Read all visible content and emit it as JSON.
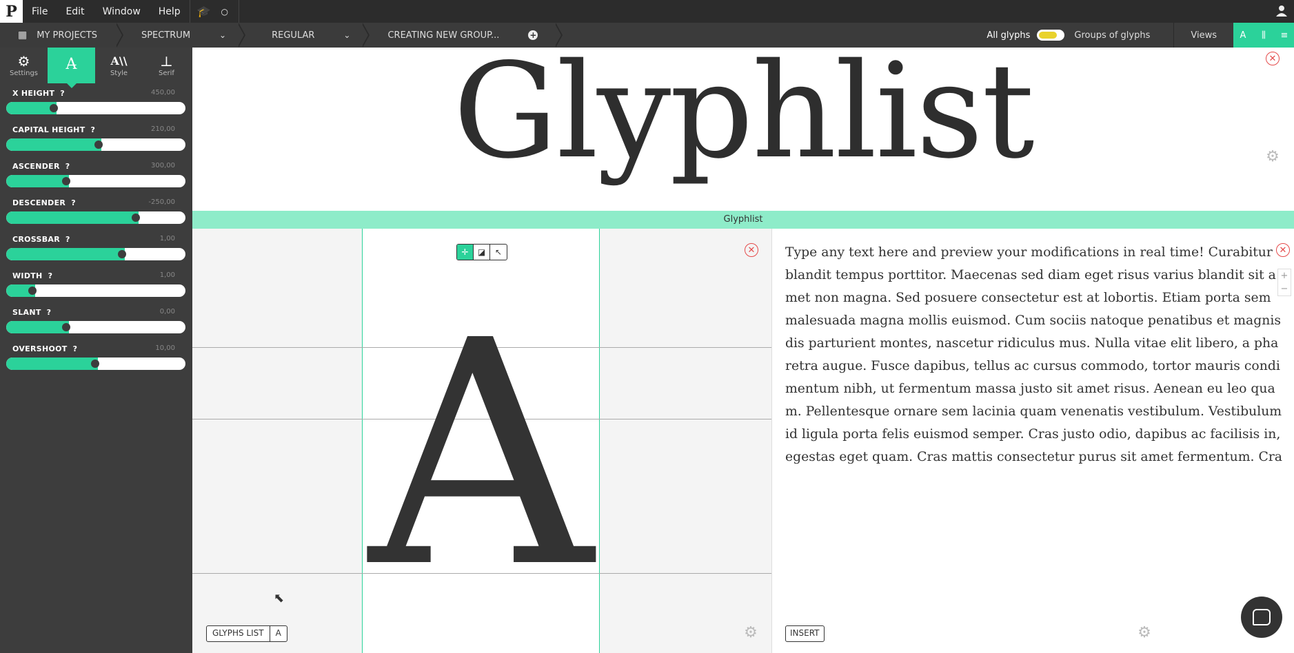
{
  "menu": {
    "logo": "P",
    "items": [
      "File",
      "Edit",
      "Window",
      "Help"
    ],
    "circle_indicator": "○"
  },
  "breadcrumb": {
    "projects": "MY PROJECTS",
    "family": "SPECTRUM",
    "variant": "REGULAR",
    "group": "CREATING NEW GROUP..."
  },
  "toolbar_right": {
    "all_glyphs": "All glyphs",
    "groups_of_glyphs": "Groups of glyphs",
    "views": "Views",
    "view_a": "A"
  },
  "sidebar": {
    "tabs": [
      {
        "label": "Settings",
        "icon": "settings-icon",
        "glyph": "⚙"
      },
      {
        "label": "",
        "icon": "font-params-icon",
        "glyph": "A̶"
      },
      {
        "label": "Style",
        "icon": "style-icon",
        "glyph": "A\\\\"
      },
      {
        "label": "Serif",
        "icon": "serif-icon",
        "glyph": "⊥"
      }
    ],
    "sliders": [
      {
        "label": "X HEIGHT",
        "value": "450,00",
        "fraction": 0.28
      },
      {
        "label": "CAPITAL HEIGHT",
        "value": "210,00",
        "fraction": 0.53
      },
      {
        "label": "ASCENDER",
        "value": "300,00",
        "fraction": 0.35
      },
      {
        "label": "DESCENDER",
        "value": "-250,00",
        "fraction": 0.74
      },
      {
        "label": "CROSSBAR",
        "value": "1,00",
        "fraction": 0.66
      },
      {
        "label": "WIDTH",
        "value": "1,00",
        "fraction": 0.16
      },
      {
        "label": "SLANT",
        "value": "0,00",
        "fraction": 0.35
      },
      {
        "label": "OVERSHOOT",
        "value": "10,00",
        "fraction": 0.51
      }
    ],
    "help_mark": "?"
  },
  "preview": {
    "word": "Glyphlist",
    "strip_label": "Glyphlist"
  },
  "editor": {
    "glyph": "A",
    "glyphs_list_label": "GLYPHS LIST",
    "current_glyph": "A"
  },
  "textview": {
    "text": "Type any text here and preview your modifications in real time! Curabitur blandit tempus porttitor. Maecenas sed diam eget risus varius blandit sit amet non magna. Sed posuere consectetur est at lobortis. Etiam porta sem malesuada magna mollis euismod. Cum sociis natoque penatibus et magnis dis parturient montes, nascetur ridiculus mus. Nulla vitae elit libero, a pharetra augue. Fusce dapibus, tellus ac cursus commodo, tortor mauris condimentum nibh, ut fermentum massa justo sit amet risus. Aenean eu leo quam. Pellentesque ornare sem lacinia quam venenatis vestibulum. Vestibulum id ligula porta felis euismod semper. Cras justo odio, dapibus ac facilisis in, egestas eget quam. Cras mattis consectetur purus sit amet fermentum. Cras mattis consectetur purus sit amet fermentum. Cum sociis natoque penatibus et magnis dis parturient montes, nascetur ridiculus mus. Vivamus sagittis lacus vel augue laoreet rutrum faucibus dolor auctor. Donec sed odio dui.",
    "insert_label": "INSERT",
    "zoom_in": "+",
    "zoom_out": "−"
  },
  "colors": {
    "accent": "#2bd29a",
    "strip": "#8eecc9",
    "toggle_knob": "#e9d22c",
    "close": "#e54b4b"
  }
}
